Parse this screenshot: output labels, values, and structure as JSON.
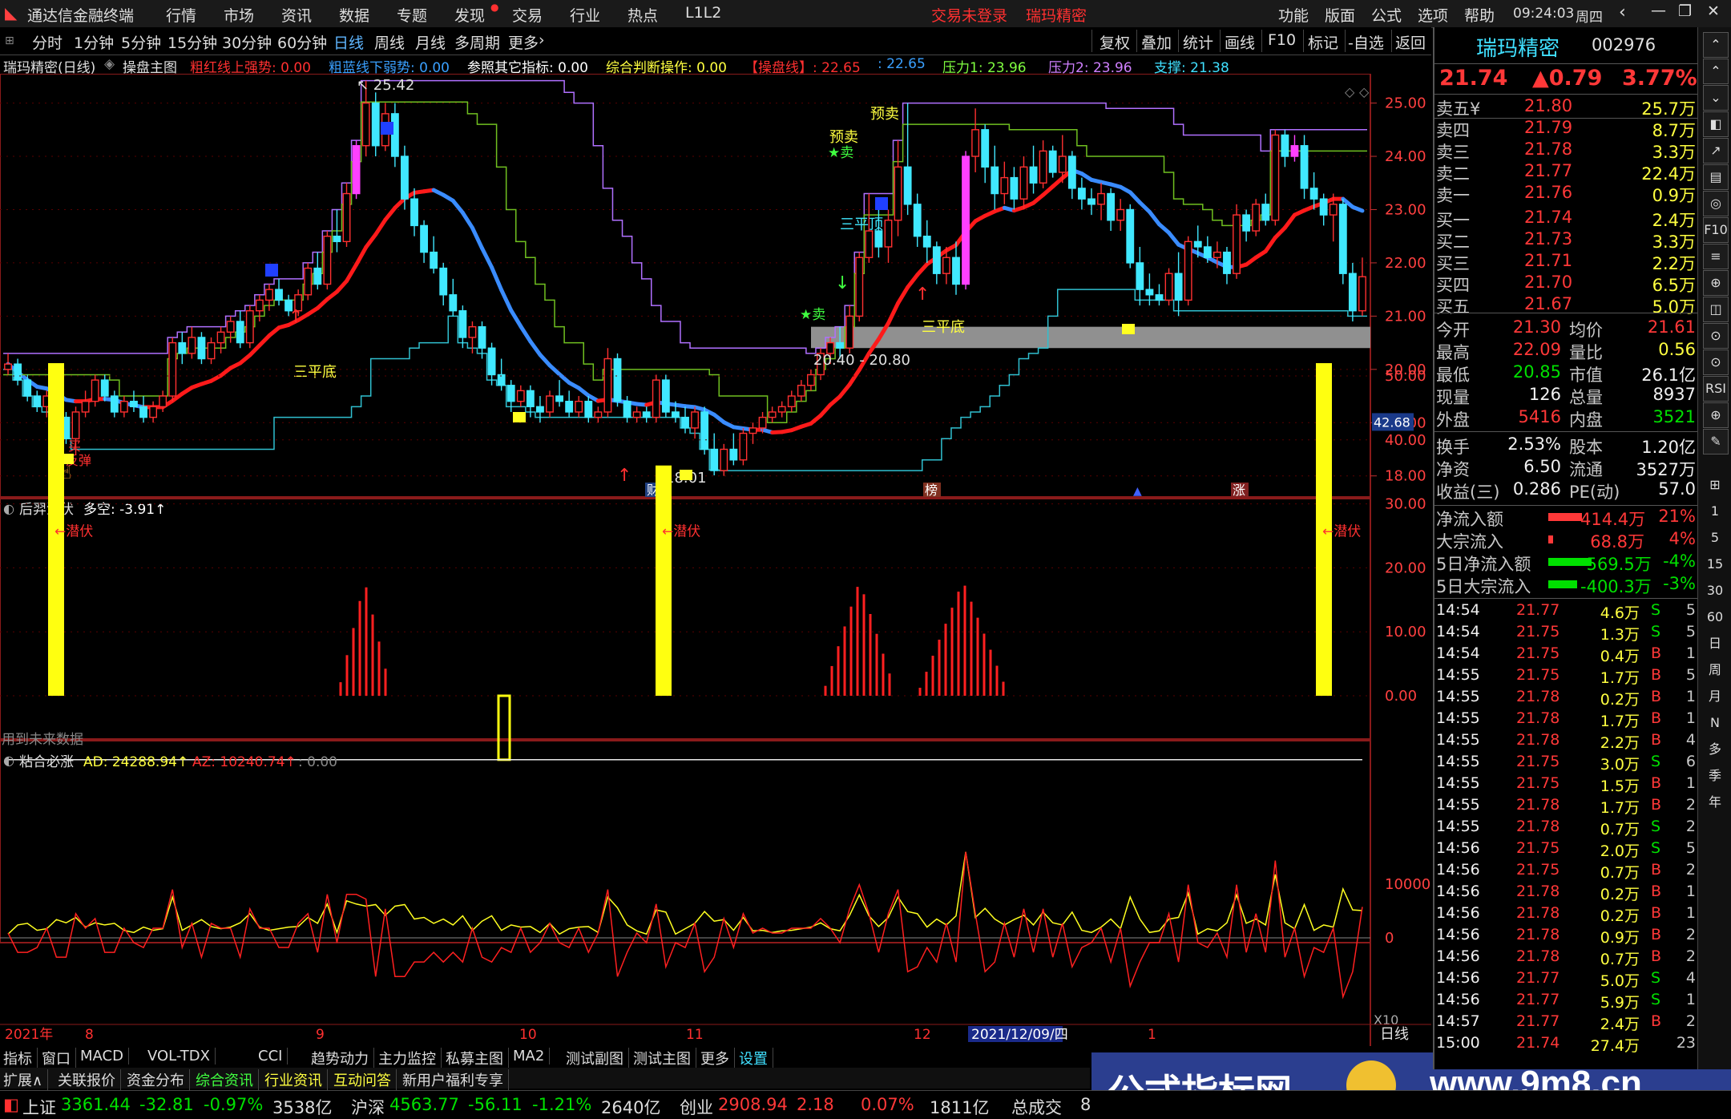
{
  "titlebar": {
    "app_title": "通达信金融终端",
    "menus": [
      "行情",
      "市场",
      "资讯",
      "数据",
      "专题",
      "发现",
      "交易",
      "行业",
      "热点",
      "L1L2"
    ],
    "login_status": "交易未登录",
    "stock_name": "瑞玛精密",
    "right_menus": [
      "功能",
      "版面",
      "公式",
      "选项",
      "帮助"
    ],
    "time": "09:24:03",
    "weekday": "周四"
  },
  "periodbar": {
    "periods": [
      "分时",
      "1分钟",
      "5分钟",
      "15分钟",
      "30分钟",
      "60分钟",
      "日线",
      "周线",
      "月线",
      "多周期",
      "更多"
    ],
    "active": "日线",
    "tools": [
      "复权",
      "叠加",
      "统计",
      "画线",
      "F10",
      "标记",
      "-自选",
      "返回"
    ]
  },
  "main_chart": {
    "legend": {
      "title": "瑞玛精密(日线)",
      "formula": "操盘主图",
      "items": [
        {
          "label": "粗红线上强势:",
          "value": "0.00",
          "color": "#ff3030"
        },
        {
          "label": "粗蓝线下弱势:",
          "value": "0.00",
          "color": "#3aa0ff"
        },
        {
          "label": "参照其它指标:",
          "value": "0.00",
          "color": "#ffffff"
        },
        {
          "label": "综合判断操作:",
          "value": "0.00",
          "color": "#ffff40"
        },
        {
          "label": "【操盘线】:",
          "value": "22.65",
          "color": "#ff3030"
        },
        {
          "label": ":",
          "value": "22.65",
          "color": "#3aa0ff"
        },
        {
          "label": "压力1:",
          "value": "23.96",
          "color": "#80ff40"
        },
        {
          "label": "压力2:",
          "value": "23.96",
          "color": "#d080ff"
        },
        {
          "label": "支撑:",
          "value": "21.38",
          "color": "#40e0ff"
        }
      ]
    },
    "y_ticks": [
      "25.00",
      "24.00",
      "23.00",
      "22.00",
      "21.00",
      "20.00",
      "19.00",
      "18.00"
    ],
    "y_range": [
      17.8,
      25.4
    ],
    "annotations": {
      "high_label": "25.42",
      "low_label": "18.01",
      "range_label_1": "20.40",
      "range_label_2": "20.80",
      "sanpingdi_1": "三平底",
      "sanpingdi_2": "三平底",
      "sanpingding": "三平顶",
      "buy": "买",
      "sell": "卖",
      "fantan": "反弹",
      "yumai_1": "预卖",
      "yumai_2": "预卖",
      "event_cai": "财",
      "event_bang": "榜",
      "event_zhang": "涨"
    },
    "ohlc": [
      [
        20.0,
        20.3,
        19.9,
        20.1
      ],
      [
        20.1,
        20.2,
        19.7,
        19.8
      ],
      [
        19.8,
        19.9,
        19.4,
        19.5
      ],
      [
        19.5,
        19.6,
        19.2,
        19.3
      ],
      [
        19.3,
        19.6,
        19.1,
        19.5
      ],
      [
        19.5,
        19.6,
        19.0,
        19.1
      ],
      [
        19.1,
        19.2,
        18.6,
        18.7
      ],
      [
        18.7,
        19.3,
        18.4,
        19.2
      ],
      [
        19.2,
        19.6,
        19.1,
        19.4
      ],
      [
        19.4,
        19.9,
        19.3,
        19.8
      ],
      [
        19.8,
        19.9,
        19.4,
        19.5
      ],
      [
        19.5,
        19.6,
        19.1,
        19.2
      ],
      [
        19.2,
        19.5,
        19.1,
        19.4
      ],
      [
        19.4,
        19.6,
        19.2,
        19.3
      ],
      [
        19.3,
        19.5,
        19.0,
        19.1
      ],
      [
        19.1,
        19.4,
        19.0,
        19.3
      ],
      [
        19.3,
        19.6,
        19.2,
        19.5
      ],
      [
        19.5,
        20.6,
        19.4,
        20.5
      ],
      [
        20.5,
        20.7,
        20.1,
        20.3
      ],
      [
        20.3,
        20.8,
        20.2,
        20.6
      ],
      [
        20.6,
        20.7,
        20.1,
        20.2
      ],
      [
        20.2,
        20.6,
        20.1,
        20.5
      ],
      [
        20.5,
        20.8,
        20.3,
        20.7
      ],
      [
        20.7,
        21.0,
        20.5,
        20.9
      ],
      [
        20.9,
        21.1,
        20.4,
        20.5
      ],
      [
        20.5,
        21.2,
        20.4,
        21.1
      ],
      [
        21.1,
        21.4,
        20.9,
        21.3
      ],
      [
        21.3,
        21.6,
        21.1,
        21.5
      ],
      [
        21.5,
        21.7,
        21.2,
        21.3
      ],
      [
        21.3,
        21.4,
        21.0,
        21.1
      ],
      [
        21.1,
        21.5,
        21.0,
        21.4
      ],
      [
        21.4,
        22.0,
        21.3,
        21.9
      ],
      [
        21.9,
        22.2,
        21.5,
        21.6
      ],
      [
        21.6,
        22.6,
        21.5,
        22.5
      ],
      [
        22.5,
        23.0,
        22.2,
        22.4
      ],
      [
        22.4,
        23.5,
        22.3,
        23.3
      ],
      [
        23.3,
        24.3,
        23.2,
        24.2
      ],
      [
        24.2,
        25.42,
        24.0,
        25.0
      ],
      [
        25.0,
        25.2,
        24.0,
        24.2
      ],
      [
        24.2,
        25.0,
        24.1,
        24.8
      ],
      [
        24.8,
        25.0,
        23.8,
        24.0
      ],
      [
        24.0,
        24.2,
        23.0,
        23.2
      ],
      [
        23.2,
        23.4,
        22.5,
        22.7
      ],
      [
        22.7,
        22.8,
        22.0,
        22.2
      ],
      [
        22.2,
        22.5,
        21.8,
        21.9
      ],
      [
        21.9,
        22.0,
        21.2,
        21.4
      ],
      [
        21.4,
        21.7,
        21.0,
        21.1
      ],
      [
        21.1,
        21.2,
        20.4,
        20.6
      ],
      [
        20.6,
        20.9,
        20.3,
        20.8
      ],
      [
        20.8,
        20.9,
        20.2,
        20.4
      ],
      [
        20.4,
        20.5,
        19.7,
        19.9
      ],
      [
        19.9,
        20.2,
        19.6,
        19.7
      ],
      [
        19.7,
        19.8,
        19.2,
        19.4
      ],
      [
        19.4,
        19.7,
        19.3,
        19.6
      ],
      [
        19.6,
        19.7,
        19.1,
        19.3
      ],
      [
        19.3,
        19.5,
        19.0,
        19.2
      ],
      [
        19.2,
        19.6,
        19.1,
        19.5
      ],
      [
        19.5,
        19.8,
        19.3,
        19.4
      ],
      [
        19.4,
        19.6,
        19.1,
        19.2
      ],
      [
        19.2,
        19.5,
        19.1,
        19.4
      ],
      [
        19.4,
        19.5,
        19.0,
        19.1
      ],
      [
        19.1,
        19.3,
        19.0,
        19.2
      ],
      [
        19.2,
        20.4,
        19.1,
        20.2
      ],
      [
        20.2,
        20.3,
        19.3,
        19.4
      ],
      [
        19.4,
        19.5,
        19.0,
        19.1
      ],
      [
        19.1,
        19.3,
        19.0,
        19.2
      ],
      [
        19.2,
        19.3,
        19.0,
        19.1
      ],
      [
        19.1,
        19.9,
        19.0,
        19.8
      ],
      [
        19.8,
        19.9,
        19.1,
        19.2
      ],
      [
        19.2,
        19.4,
        19.0,
        19.1
      ],
      [
        19.1,
        19.3,
        18.8,
        18.9
      ],
      [
        18.9,
        19.3,
        18.7,
        19.2
      ],
      [
        19.2,
        19.3,
        18.4,
        18.5
      ],
      [
        18.5,
        18.8,
        18.01,
        18.1
      ],
      [
        18.1,
        18.6,
        18.0,
        18.5
      ],
      [
        18.5,
        18.8,
        18.2,
        18.3
      ],
      [
        18.3,
        18.9,
        18.2,
        18.8
      ],
      [
        18.8,
        19.0,
        18.6,
        18.9
      ],
      [
        18.9,
        19.2,
        18.8,
        19.1
      ],
      [
        19.1,
        19.3,
        19.0,
        19.2
      ],
      [
        19.2,
        19.4,
        19.1,
        19.3
      ],
      [
        19.3,
        19.6,
        19.2,
        19.5
      ],
      [
        19.5,
        19.8,
        19.4,
        19.7
      ],
      [
        19.7,
        20.0,
        19.6,
        19.9
      ],
      [
        19.9,
        20.4,
        19.8,
        20.3
      ],
      [
        20.3,
        20.6,
        20.1,
        20.5
      ],
      [
        20.5,
        20.8,
        20.2,
        20.4
      ],
      [
        20.4,
        21.2,
        20.3,
        21.0
      ],
      [
        21.0,
        22.2,
        20.9,
        22.1
      ],
      [
        22.1,
        23.3,
        22.0,
        22.6
      ],
      [
        22.6,
        23.0,
        22.1,
        22.3
      ],
      [
        22.3,
        23.0,
        22.0,
        22.8
      ],
      [
        22.8,
        24.3,
        22.5,
        23.8
      ],
      [
        23.8,
        25.0,
        22.9,
        23.1
      ],
      [
        23.1,
        23.3,
        22.3,
        22.5
      ],
      [
        22.5,
        22.8,
        22.0,
        22.3
      ],
      [
        22.3,
        22.4,
        21.6,
        21.8
      ],
      [
        21.8,
        22.3,
        21.6,
        22.1
      ],
      [
        22.1,
        22.4,
        21.4,
        21.6
      ],
      [
        21.6,
        24.1,
        21.5,
        24.0
      ],
      [
        24.0,
        24.9,
        23.7,
        24.5
      ],
      [
        24.5,
        24.6,
        23.5,
        23.8
      ],
      [
        23.8,
        24.2,
        23.0,
        23.3
      ],
      [
        23.3,
        23.9,
        23.1,
        23.6
      ],
      [
        23.6,
        23.8,
        23.0,
        23.2
      ],
      [
        23.2,
        24.0,
        23.0,
        23.8
      ],
      [
        23.8,
        24.2,
        23.3,
        23.5
      ],
      [
        23.5,
        24.3,
        23.4,
        24.1
      ],
      [
        24.1,
        24.2,
        23.6,
        23.7
      ],
      [
        23.7,
        24.4,
        23.5,
        24.0
      ],
      [
        24.0,
        24.1,
        23.2,
        23.4
      ],
      [
        23.4,
        23.6,
        23.0,
        23.2
      ],
      [
        23.2,
        23.4,
        22.9,
        23.1
      ],
      [
        23.1,
        23.5,
        22.8,
        23.3
      ],
      [
        23.3,
        23.4,
        22.6,
        22.8
      ],
      [
        22.8,
        23.2,
        22.6,
        23.0
      ],
      [
        23.0,
        23.1,
        21.9,
        22.0
      ],
      [
        22.0,
        22.3,
        21.2,
        21.5
      ],
      [
        21.5,
        21.8,
        21.2,
        21.4
      ],
      [
        21.4,
        21.6,
        21.2,
        21.3
      ],
      [
        21.3,
        21.9,
        21.2,
        21.8
      ],
      [
        21.8,
        22.2,
        21.0,
        21.3
      ],
      [
        21.3,
        22.5,
        21.2,
        22.4
      ],
      [
        22.4,
        22.7,
        22.1,
        22.3
      ],
      [
        22.3,
        22.5,
        22.0,
        22.1
      ],
      [
        22.1,
        22.4,
        21.9,
        22.2
      ],
      [
        22.2,
        22.3,
        21.6,
        21.8
      ],
      [
        21.8,
        23.1,
        21.7,
        22.9
      ],
      [
        22.9,
        23.0,
        22.4,
        22.6
      ],
      [
        22.6,
        23.2,
        22.5,
        23.1
      ],
      [
        23.1,
        23.3,
        22.7,
        22.8
      ],
      [
        22.8,
        24.5,
        22.7,
        24.4
      ],
      [
        24.4,
        24.5,
        23.8,
        24.0
      ],
      [
        24.0,
        24.4,
        23.9,
        24.2
      ],
      [
        24.2,
        24.4,
        23.2,
        23.4
      ],
      [
        23.4,
        23.7,
        23.0,
        23.2
      ],
      [
        23.2,
        23.3,
        22.7,
        22.9
      ],
      [
        22.9,
        23.3,
        22.4,
        23.1
      ],
      [
        23.1,
        23.2,
        21.6,
        21.8
      ],
      [
        21.8,
        22.0,
        20.9,
        21.1
      ],
      [
        21.1,
        22.1,
        21.0,
        21.74
      ]
    ]
  },
  "indicator1": {
    "title": "后羿潜伏",
    "label": "多空:",
    "value": "-3.91",
    "y_ticks": [
      "50.00",
      "40.00",
      "30.00",
      "20.00",
      "10.00",
      "0.00"
    ],
    "side_value": "42.68",
    "tag": "←潜伏",
    "note": "用到未来数据"
  },
  "indicator2": {
    "title": "粘合必涨",
    "ad_label": "AD:",
    "ad_value": "24288.94",
    "az_label": "AZ:",
    "az_value": "10240.74",
    "third": ": 0.00",
    "y_ticks": [
      "10000",
      "0"
    ],
    "scale": "X10"
  },
  "time_axis": {
    "labels": [
      "2021年",
      "8",
      "9",
      "10",
      "11",
      "12",
      "2021/12/09/四",
      "1"
    ],
    "period": "日线"
  },
  "bottom_tabs1": [
    "指标",
    "窗口",
    "MACD",
    "VOL-TDX",
    "CCI",
    "趋势动力",
    "主力监控",
    "私募主图",
    "MA2",
    "测试副图",
    "测试主图",
    "更多",
    "设置"
  ],
  "bottom_tabs2": [
    "扩展∧",
    "关联报价",
    "资金分布",
    "综合资讯",
    "行业资讯",
    "互动问答",
    "新用户福利专享"
  ],
  "quote": {
    "name": "瑞玛精密",
    "code": "002976",
    "price": "21.74",
    "change": "▲0.79",
    "pct": "3.77%",
    "asks": [
      {
        "label": "卖五",
        "price": "21.80",
        "vol": "25.7万"
      },
      {
        "label": "卖四",
        "price": "21.79",
        "vol": "8.7万"
      },
      {
        "label": "卖三",
        "price": "21.78",
        "vol": "3.3万"
      },
      {
        "label": "卖二",
        "price": "21.77",
        "vol": "22.4万"
      },
      {
        "label": "卖一",
        "price": "21.76",
        "vol": "0.9万"
      }
    ],
    "bids": [
      {
        "label": "买一",
        "price": "21.74",
        "vol": "2.4万"
      },
      {
        "label": "买二",
        "price": "21.73",
        "vol": "3.3万"
      },
      {
        "label": "买三",
        "price": "21.71",
        "vol": "2.2万"
      },
      {
        "label": "买四",
        "price": "21.70",
        "vol": "6.5万"
      },
      {
        "label": "买五",
        "price": "21.67",
        "vol": "5.0万"
      }
    ],
    "stats": [
      {
        "l1": "今开",
        "v1": "21.30",
        "c1": "rd",
        "l2": "均价",
        "v2": "21.61",
        "c2": "rd"
      },
      {
        "l1": "最高",
        "v1": "22.09",
        "c1": "rd",
        "l2": "量比",
        "v2": "0.56",
        "c2": "yl"
      },
      {
        "l1": "最低",
        "v1": "20.85",
        "c1": "gn",
        "l2": "市值",
        "v2": "26.1亿",
        "c2": "wh"
      },
      {
        "l1": "现量",
        "v1": "126",
        "c1": "wh",
        "l2": "总量",
        "v2": "8937",
        "c2": "wh"
      },
      {
        "l1": "外盘",
        "v1": "5416",
        "c1": "rd",
        "l2": "内盘",
        "v2": "3521",
        "c2": "gn"
      }
    ],
    "stats2": [
      {
        "l1": "换手",
        "v1": "2.53%",
        "l2": "股本",
        "v2": "1.20亿"
      },
      {
        "l1": "净资",
        "v1": "6.50",
        "l2": "流通",
        "v2": "3527万"
      },
      {
        "l1": "收益(三)",
        "v1": "0.286",
        "l2": "PE(动)",
        "v2": "57.0"
      }
    ],
    "flows": [
      {
        "label": "净流入额",
        "value": "414.4万",
        "pct": "21%",
        "color": "#ff3838",
        "bar": 0.7
      },
      {
        "label": "大宗流入",
        "value": "68.8万",
        "pct": "4%",
        "color": "#ff3838",
        "bar": 0.1
      },
      {
        "label": "5日净流入额",
        "value": "-569.5万",
        "pct": "-4%",
        "color": "#00e000",
        "bar": 0.9
      },
      {
        "label": "5日大宗流入",
        "value": "-400.3万",
        "pct": "-3%",
        "color": "#00e000",
        "bar": 0.6
      }
    ],
    "ticks": [
      [
        "14:54",
        "21.77",
        "4.6万",
        "S",
        "5"
      ],
      [
        "14:54",
        "21.75",
        "1.3万",
        "S",
        "5"
      ],
      [
        "14:54",
        "21.75",
        "0.4万",
        "B",
        "1"
      ],
      [
        "14:55",
        "21.75",
        "1.7万",
        "B",
        "5"
      ],
      [
        "14:55",
        "21.78",
        "0.2万",
        "B",
        "1"
      ],
      [
        "14:55",
        "21.78",
        "1.7万",
        "B",
        "1"
      ],
      [
        "14:55",
        "21.78",
        "2.2万",
        "B",
        "4"
      ],
      [
        "14:55",
        "21.75",
        "3.0万",
        "S",
        "6"
      ],
      [
        "14:55",
        "21.75",
        "1.5万",
        "B",
        "1"
      ],
      [
        "14:55",
        "21.78",
        "1.7万",
        "B",
        "2"
      ],
      [
        "14:55",
        "21.78",
        "0.7万",
        "S",
        "2"
      ],
      [
        "14:56",
        "21.75",
        "2.0万",
        "S",
        "5"
      ],
      [
        "14:56",
        "21.75",
        "0.7万",
        "B",
        "2"
      ],
      [
        "14:56",
        "21.78",
        "0.2万",
        "B",
        "1"
      ],
      [
        "14:56",
        "21.78",
        "0.2万",
        "B",
        "1"
      ],
      [
        "14:56",
        "21.78",
        "0.9万",
        "B",
        "2"
      ],
      [
        "14:56",
        "21.78",
        "0.7万",
        "B",
        "2"
      ],
      [
        "14:56",
        "21.77",
        "5.0万",
        "S",
        "4"
      ],
      [
        "14:56",
        "21.77",
        "5.9万",
        "S",
        "1"
      ],
      [
        "14:57",
        "21.77",
        "2.4万",
        "B",
        "2"
      ],
      [
        "15:00",
        "21.74",
        "27.4万",
        "",
        "23"
      ]
    ]
  },
  "sidebar": [
    "⌃",
    "⌃",
    "⌄",
    "◧",
    "↗",
    "▤",
    "◎",
    "F10",
    "≡",
    "⊕",
    "◫",
    "⊙",
    "⊙",
    "RSI",
    "⊕",
    "✎",
    "⊞",
    "1",
    "5",
    "15",
    "30",
    "60",
    "日",
    "周",
    "月",
    "N",
    "多",
    "季",
    "年"
  ],
  "status": {
    "items": [
      {
        "label": "上证",
        "value": "3361.44",
        "chg": "-32.81",
        "pct": "-0.97%",
        "amt": "3538亿"
      },
      {
        "label": "沪深",
        "value": "4563.77",
        "chg": "-56.11",
        "pct": "-1.21%",
        "amt": "2640亿"
      },
      {
        "label": "创业",
        "value": "2908.94",
        "chg": "2.18",
        "pct": "0.07%",
        "amt": "1811亿"
      }
    ],
    "last": "总成交",
    "last_digit": "8"
  },
  "watermark": {
    "text": "公式指标网",
    "url": "www.9m8.cn"
  }
}
